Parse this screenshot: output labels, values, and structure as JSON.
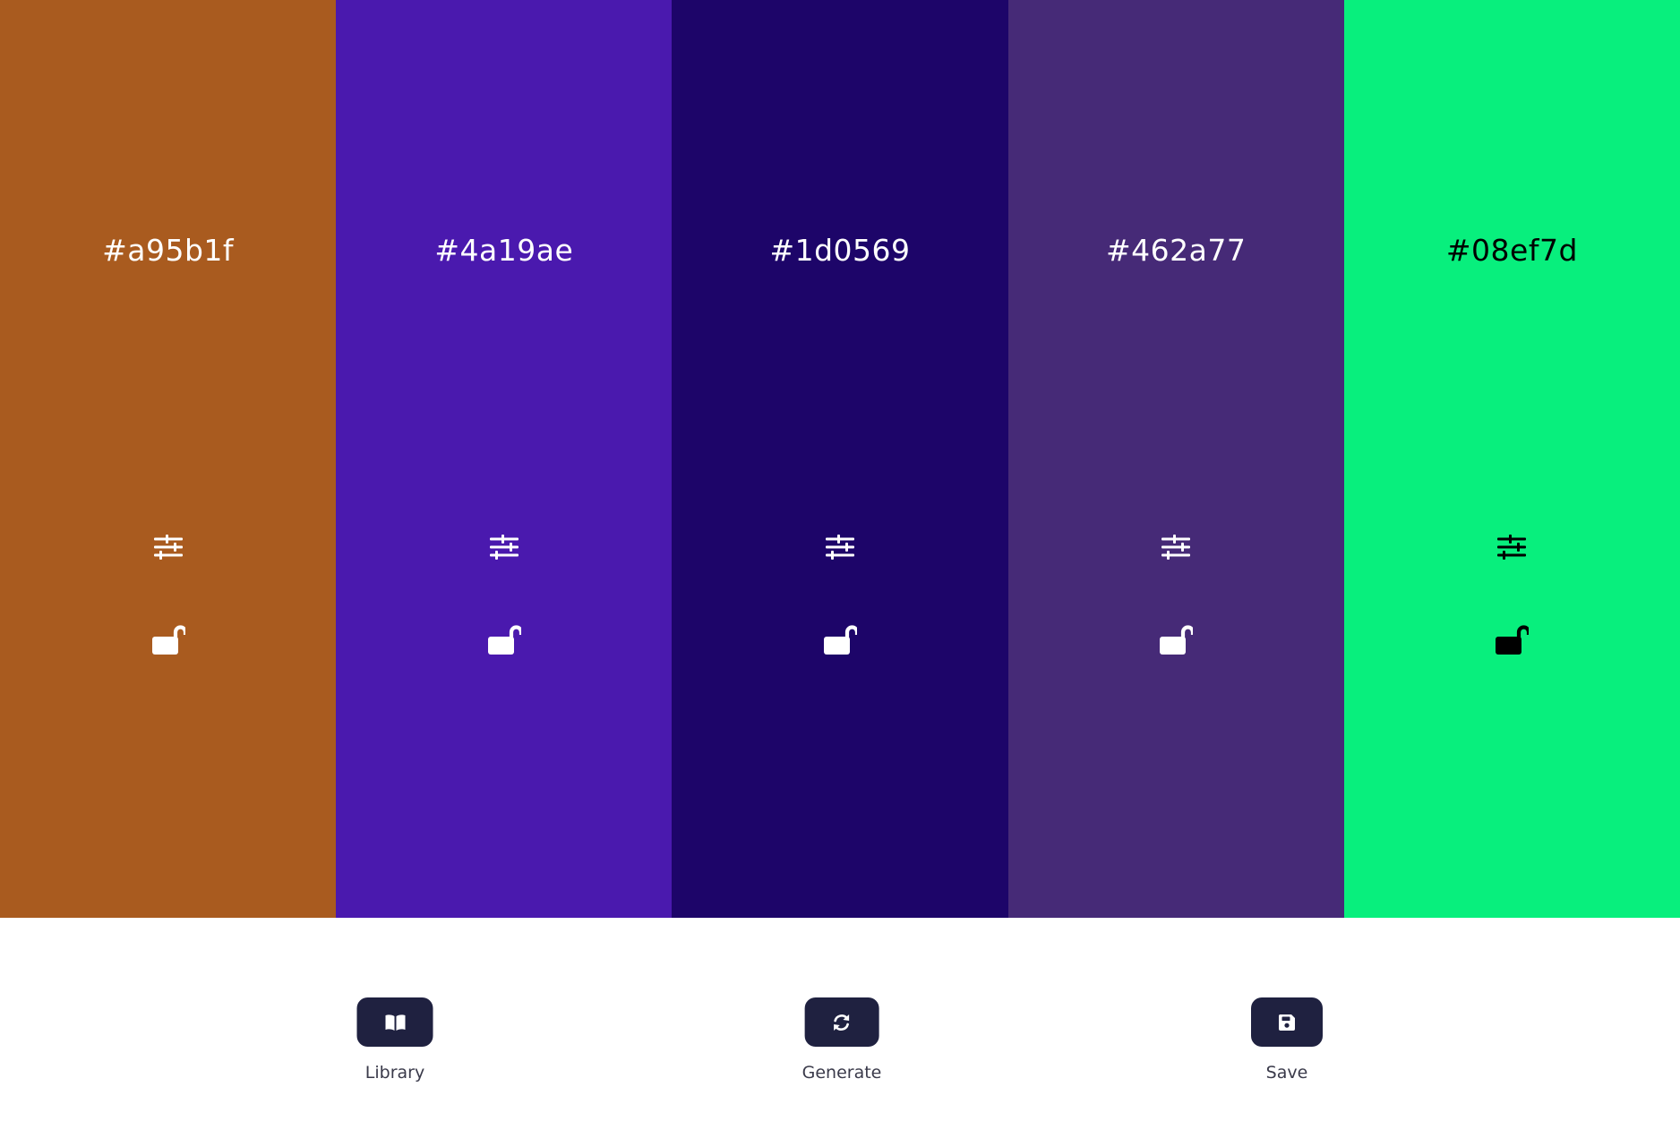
{
  "palette": {
    "swatches": [
      {
        "hex": "#a95b1f",
        "text_color": "#ffffff",
        "locked": false
      },
      {
        "hex": "#4a19ae",
        "text_color": "#ffffff",
        "locked": false
      },
      {
        "hex": "#1d0569",
        "text_color": "#ffffff",
        "locked": false
      },
      {
        "hex": "#462a77",
        "text_color": "#ffffff",
        "locked": false
      },
      {
        "hex": "#08ef7d",
        "text_color": "#000000",
        "locked": false
      }
    ],
    "icons": {
      "adjust": "sliders-icon",
      "lock": "unlocked-padlock-icon"
    }
  },
  "toolbar": {
    "library": {
      "label": "Library",
      "icon": "book-open-icon"
    },
    "generate": {
      "label": "Generate",
      "icon": "refresh-icon"
    },
    "save": {
      "label": "Save",
      "icon": "floppy-disk-icon"
    },
    "button_color": "#1f2140"
  }
}
